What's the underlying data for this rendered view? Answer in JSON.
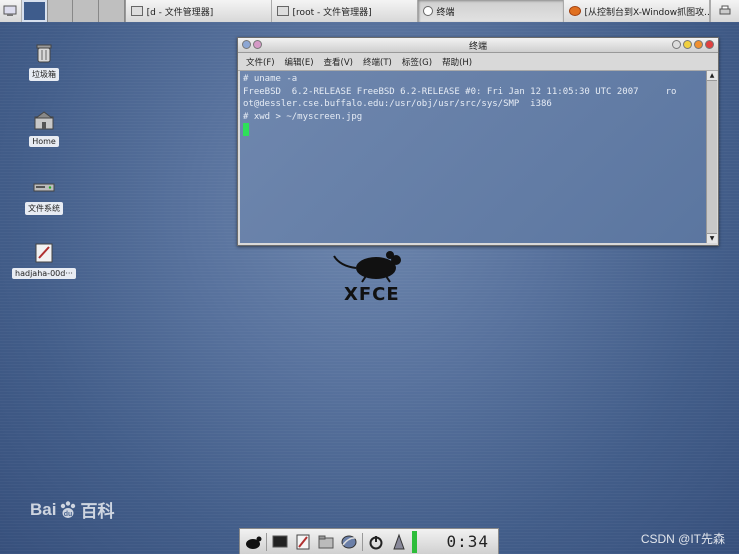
{
  "top_panel": {
    "tasks": [
      {
        "label": "[d - 文件管理器]",
        "icon": "folder-icon"
      },
      {
        "label": "[root - 文件管理器]",
        "icon": "folder-icon"
      },
      {
        "label": "终端",
        "icon": "terminal-icon",
        "active": true
      },
      {
        "label": "[从控制台到X-Window抓图攻...",
        "icon": "firefox-icon"
      }
    ]
  },
  "desktop_icons": [
    {
      "label": "垃圾箱",
      "icon": "trash-icon"
    },
    {
      "label": "Home",
      "icon": "home-folder-icon"
    },
    {
      "label": "文件系统",
      "icon": "drive-icon"
    },
    {
      "label": "hadjaha-00d···",
      "icon": "document-icon"
    }
  ],
  "terminal": {
    "title": "终端",
    "menu": [
      "文件(F)",
      "编辑(E)",
      "查看(V)",
      "终端(T)",
      "标签(G)",
      "帮助(H)"
    ],
    "lines": [
      "# uname -a",
      "FreeBSD  6.2-RELEASE FreeBSD 6.2-RELEASE #0: Fri Jan 12 11:05:30 UTC 2007     ro",
      "ot@dessler.cse.buffalo.edu:/usr/obj/usr/src/sys/SMP  i386",
      "# xwd > ~/myscreen.jpg"
    ]
  },
  "logo": {
    "text": "XFCE"
  },
  "watermarks": {
    "baidu": "Bai百科",
    "baidu_du": "du",
    "csdn": "CSDN @IT先森"
  },
  "bottom_panel": {
    "clock": "0:34"
  },
  "colors": {
    "desktop": "#4f6b95",
    "cursor": "#2ee05a",
    "terminal_bg": "#6f87ae"
  }
}
